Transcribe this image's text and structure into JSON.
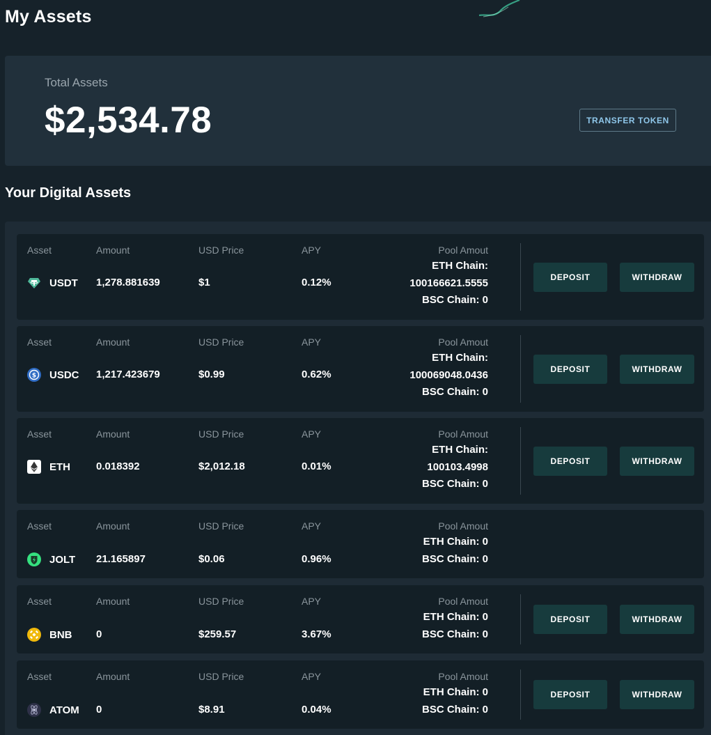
{
  "page": {
    "title": "My Assets"
  },
  "summary": {
    "label": "Total Assets",
    "value": "$2,534.78",
    "transfer_label": "TRANSFER TOKEN"
  },
  "assets_section": {
    "title": "Your Digital Assets"
  },
  "columns": {
    "asset": "Asset",
    "amount": "Amount",
    "usd_price": "USD Price",
    "apy": "APY",
    "pool": "Pool Amout"
  },
  "buttons": {
    "deposit": "DEPOSIT",
    "withdraw": "WITHDRAW"
  },
  "assets": [
    {
      "symbol": "USDT",
      "icon": "tether-icon",
      "amount": "1,278.881639",
      "usd_price": "$1",
      "apy": "0.12%",
      "pool_lines": [
        "ETH Chain:",
        "100166621.5555",
        "BSC Chain: 0"
      ],
      "actions": true
    },
    {
      "symbol": "USDC",
      "icon": "usdc-icon",
      "amount": "1,217.423679",
      "usd_price": "$0.99",
      "apy": "0.62%",
      "pool_lines": [
        "ETH Chain:",
        "100069048.0436",
        "BSC Chain: 0"
      ],
      "actions": true
    },
    {
      "symbol": "ETH",
      "icon": "ethereum-icon",
      "amount": "0.018392",
      "usd_price": "$2,012.18",
      "apy": "0.01%",
      "pool_lines": [
        "ETH Chain:",
        "100103.4998",
        "BSC Chain: 0"
      ],
      "actions": true
    },
    {
      "symbol": "JOLT",
      "icon": "jolt-icon",
      "amount": "21.165897",
      "usd_price": "$0.06",
      "apy": "0.96%",
      "pool_lines": [
        "ETH Chain: 0",
        "BSC Chain: 0"
      ],
      "actions": false
    },
    {
      "symbol": "BNB",
      "icon": "bnb-icon",
      "amount": "0",
      "usd_price": "$259.57",
      "apy": "3.67%",
      "pool_lines": [
        "ETH Chain: 0",
        "BSC Chain: 0"
      ],
      "actions": true
    },
    {
      "symbol": "ATOM",
      "icon": "cosmos-icon",
      "amount": "0",
      "usd_price": "$8.91",
      "apy": "0.04%",
      "pool_lines": [
        "ETH Chain: 0",
        "BSC Chain: 0"
      ],
      "actions": true
    }
  ],
  "colors": {
    "background": "#16222a",
    "card": "#21303b",
    "row": "#131f26",
    "button": "#173b3d",
    "accent": "#8fc7ea"
  }
}
